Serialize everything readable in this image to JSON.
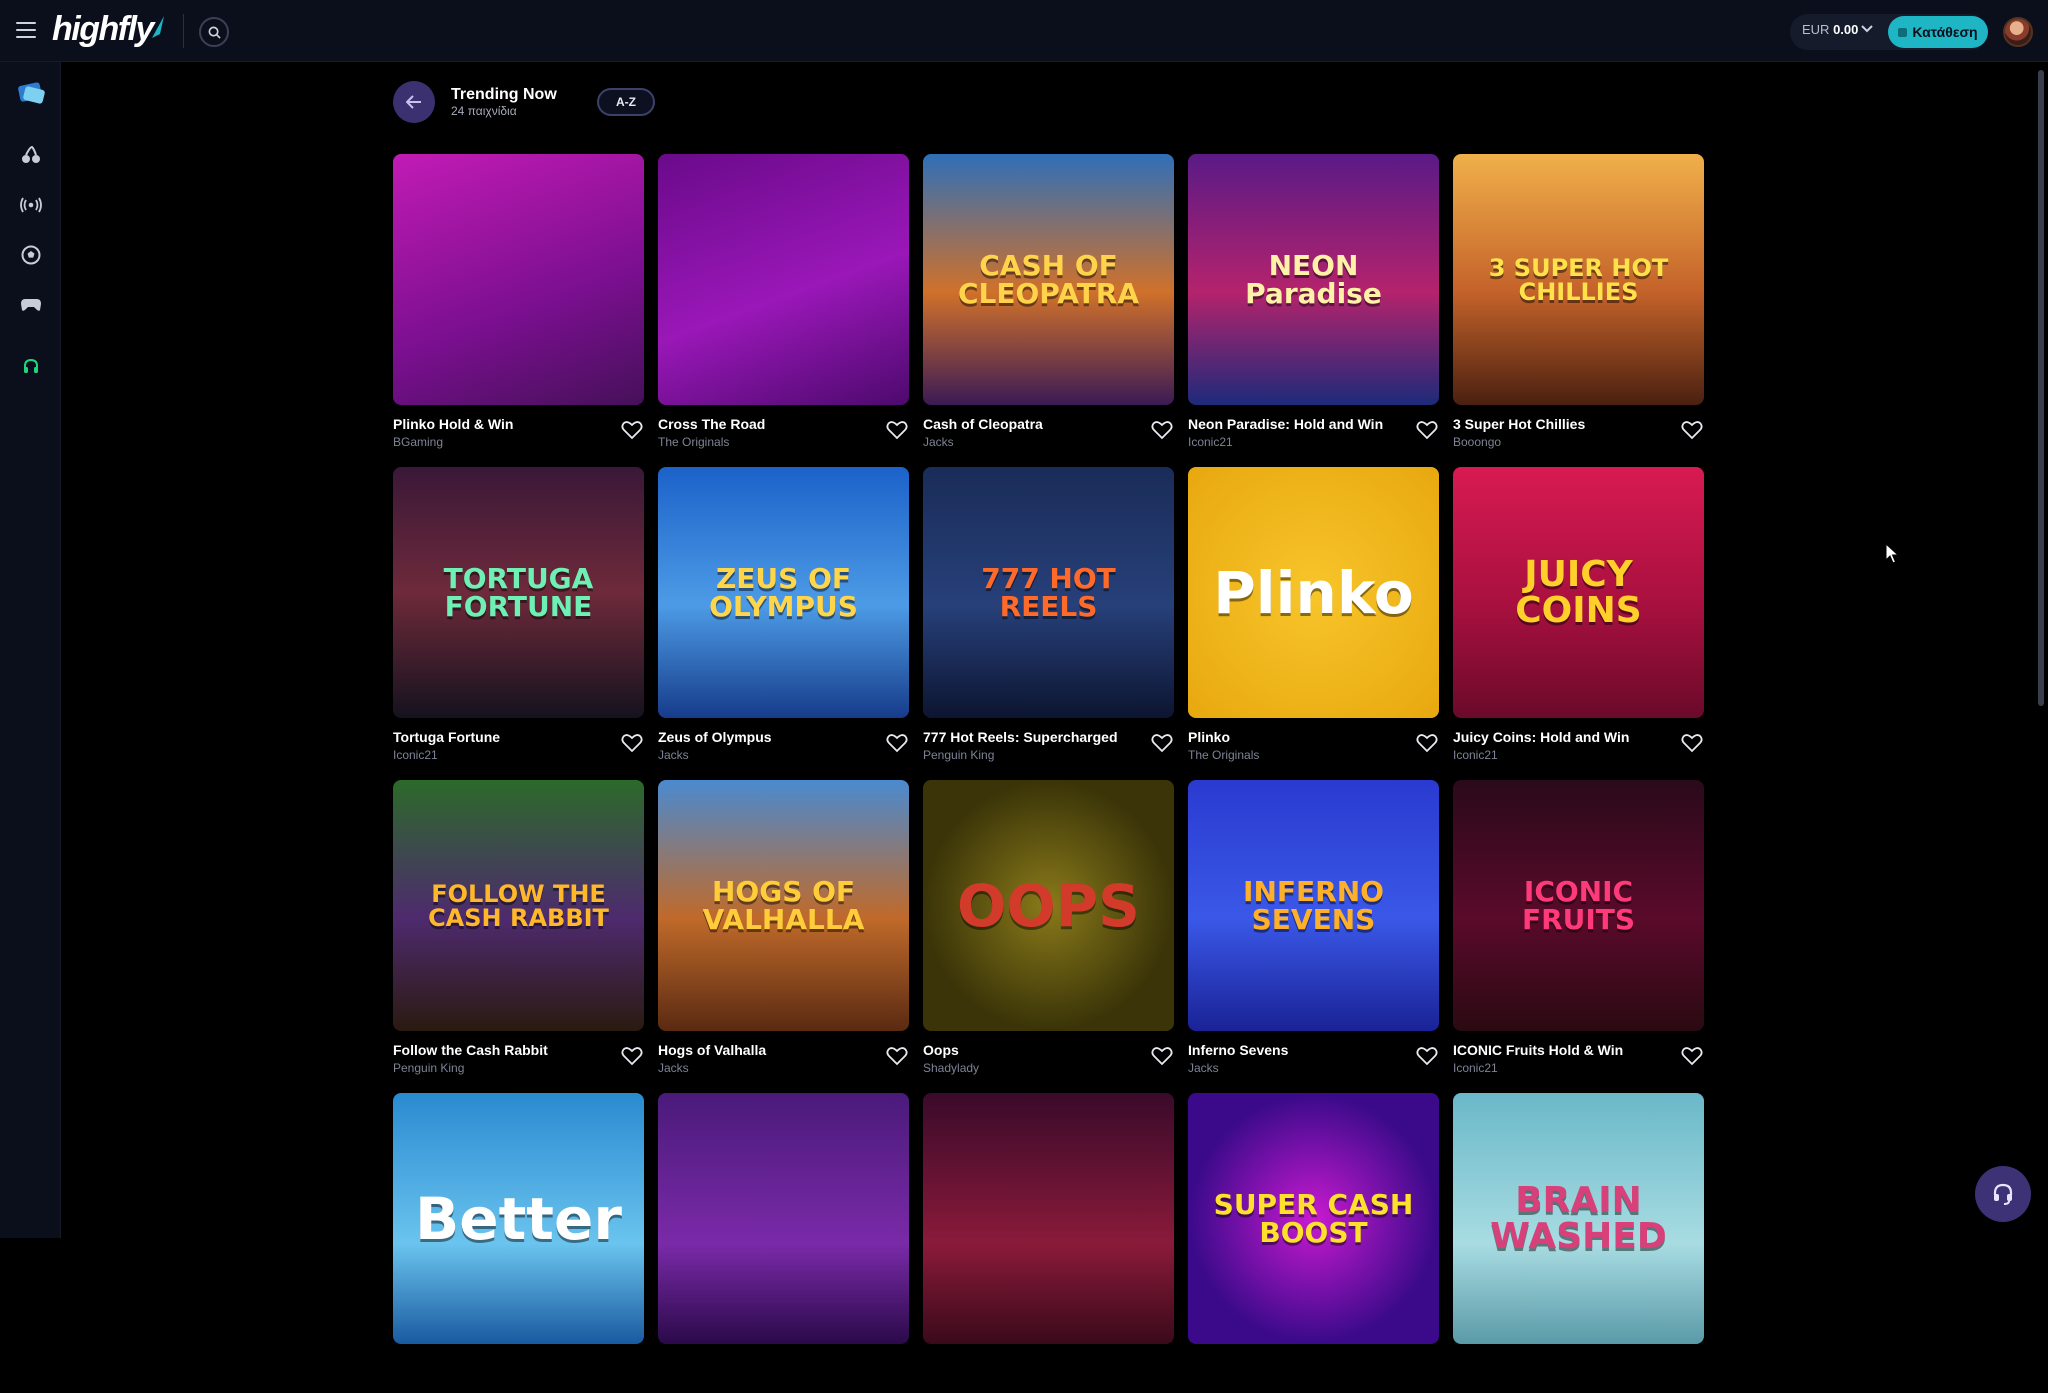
{
  "header": {
    "logo_text": "highfly",
    "balance_currency": "EUR",
    "balance_amount": "0.00",
    "deposit_label": "Κατάθεση"
  },
  "sidebar": {
    "items": [
      {
        "icon": "casino-cards-icon"
      },
      {
        "icon": "slots-cherry-icon"
      },
      {
        "icon": "live-broadcast-icon"
      },
      {
        "icon": "sports-ball-icon"
      },
      {
        "icon": "gamepad-icon"
      },
      {
        "icon": "support-headset-icon"
      }
    ]
  },
  "page": {
    "title": "Trending Now",
    "count_label": "24 παιχνίδια",
    "sort_label": "A-Z"
  },
  "games": [
    {
      "name": "Plinko Hold & Win",
      "provider": "BGaming",
      "art": "",
      "bg": "linear-gradient(160deg,#c21bb5,#7a0f8f 60%,#46105a)",
      "fg": "#ffd23a"
    },
    {
      "name": "Cross The Road",
      "provider": "The Originals",
      "art": "",
      "bg": "linear-gradient(160deg,#6a0a8a,#9a17b8 55%,#4d0a6e)",
      "fg": "#ff6ff0"
    },
    {
      "name": "Cash of Cleopatra",
      "provider": "Jacks",
      "art": "CASH OF CLEOPATRA",
      "bg": "linear-gradient(180deg,#2f6fb8,#d0712a 55%,#3b1a55)",
      "fg": "#ffd34a"
    },
    {
      "name": "Neon Paradise: Hold and Win",
      "provider": "Iconic21",
      "art": "NEON Paradise",
      "bg": "linear-gradient(180deg,#5a1a86,#b4236c 55%,#1d2a7a)",
      "fg": "#fff2a8"
    },
    {
      "name": "3 Super Hot Chillies",
      "provider": "Booongo",
      "art": "3 SUPER HOT CHILLIES",
      "bg": "linear-gradient(180deg,#f0b04a,#c4622a 55%,#4a2010)",
      "fg": "#ffe24a"
    },
    {
      "name": "Tortuga Fortune",
      "provider": "Iconic21",
      "art": "TORTUGA FORTUNE",
      "bg": "linear-gradient(180deg,#3a1838,#6e2a3a 50%,#15121e)",
      "fg": "#6ef0b4"
    },
    {
      "name": "Zeus of Olympus",
      "provider": "Jacks",
      "art": "ZEUS OF OLYMPUS",
      "bg": "linear-gradient(180deg,#1b62c9,#4d9be6 55%,#163c8a)",
      "fg": "#ffd54a"
    },
    {
      "name": "777 Hot Reels: Supercharged",
      "provider": "Penguin King",
      "art": "777 HOT REELS",
      "bg": "linear-gradient(180deg,#1a2c58,#27407a 55%,#0c1530)",
      "fg": "#ff6a2a"
    },
    {
      "name": "Plinko",
      "provider": "The Originals",
      "art": "Plinko",
      "bg": "radial-gradient(circle,#f7c52a,#e8a80f)",
      "fg": "#ffffff"
    },
    {
      "name": "Juicy Coins: Hold and Win",
      "provider": "Iconic21",
      "art": "JUICY COINS",
      "bg": "linear-gradient(180deg,#d81a52,#a8103f 55%,#6a0a2a)",
      "fg": "#ffd02a"
    },
    {
      "name": "Follow the Cash Rabbit",
      "provider": "Penguin King",
      "art": "FOLLOW THE CASH RABBIT",
      "bg": "linear-gradient(180deg,#2c6a2a,#4e2a6e 55%,#2a1a10)",
      "fg": "#ffb82a"
    },
    {
      "name": "Hogs of Valhalla",
      "provider": "Jacks",
      "art": "HOGS OF VALHALLA",
      "bg": "linear-gradient(180deg,#4a8ad0,#c06a2a 55%,#5a2a12)",
      "fg": "#ffcc3a"
    },
    {
      "name": "Oops",
      "provider": "Shadylady",
      "art": "OOPS",
      "bg": "radial-gradient(circle,#8a7a1a,#3a3408 70%)",
      "fg": "#d23a2a"
    },
    {
      "name": "Inferno Sevens",
      "provider": "Jacks",
      "art": "INFERNO SEVENS",
      "bg": "linear-gradient(180deg,#2a3ad0,#3a58e8 55%,#1a2296)",
      "fg": "#ffb02a"
    },
    {
      "name": "ICONIC Fruits Hold & Win",
      "provider": "Iconic21",
      "art": "ICONIC FRUITS",
      "bg": "linear-gradient(180deg,#2a0a1a,#5a0a2a 55%,#2a0a12)",
      "fg": "#ff3a7a"
    },
    {
      "name": "",
      "provider": "",
      "art": "Better",
      "bg": "linear-gradient(180deg,#2a8ad0,#6ac4ee 60%,#1a5aa0)",
      "fg": "#ffffff"
    },
    {
      "name": "",
      "provider": "",
      "art": "",
      "bg": "linear-gradient(180deg,#4a1a7a,#7a2aa8 60%,#2a0a4a)",
      "fg": "#a8eaff"
    },
    {
      "name": "",
      "provider": "",
      "art": "",
      "bg": "linear-gradient(180deg,#3a0a2a,#8a1a3a 60%,#3a0a1a)",
      "fg": "#ffb02a"
    },
    {
      "name": "",
      "provider": "",
      "art": "SUPER CASH BOOST",
      "bg": "radial-gradient(circle,#c81ad0,#3a0a8a 70%)",
      "fg": "#ffe02a"
    },
    {
      "name": "",
      "provider": "",
      "art": "BRAIN WASHED",
      "bg": "linear-gradient(180deg,#6ab8c8,#a8dce2 60%,#5a9aa8)",
      "fg": "#d8407a"
    }
  ]
}
